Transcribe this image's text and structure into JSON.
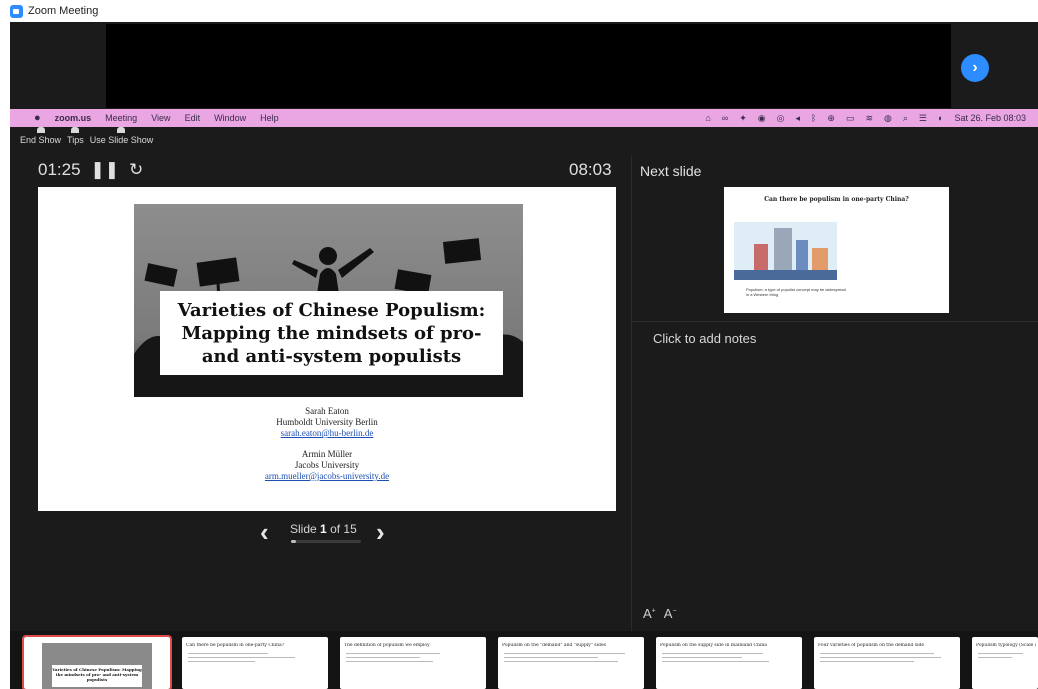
{
  "window": {
    "title": "Zoom Meeting"
  },
  "menubar": {
    "app_name": "zoom.us",
    "menus": [
      "Meeting",
      "View",
      "Edit",
      "Window",
      "Help"
    ],
    "datetime": "Sat 26. Feb 08:03"
  },
  "presenter_toolbar": {
    "items": [
      "End Show",
      "Tips",
      "Use Slide Show"
    ]
  },
  "timer": {
    "elapsed": "01:25",
    "clock": "08:03"
  },
  "current_slide": {
    "title": "Varieties of Chinese Populism: Mapping the mindsets of pro- and anti-system populists",
    "author1_name": "Sarah Eaton",
    "author1_affiliation": "Humboldt University Berlin",
    "author1_email": "sarah.eaton@hu-berlin.de",
    "author2_name": "Armin Müller",
    "author2_affiliation": "Jacobs University",
    "author2_email": "arm.mueller@jacobs-university.de"
  },
  "slide_nav": {
    "label": "Slide",
    "current": "1",
    "of": "of 15",
    "progress": 0.0667
  },
  "next_slide": {
    "label": "Next slide",
    "title": "Can there be populism in one-party China?",
    "caption": "Populism: a type of populist concept may be widespread in a Western thing"
  },
  "notes": {
    "placeholder": "Click to add notes"
  },
  "thumbnails": [
    {
      "title": "Varieties of Chinese Populism: Mapping the mindsets of pro- and anti-system populists",
      "active": true
    },
    {
      "title": "Can there be populism in one-party China?",
      "active": false
    },
    {
      "title": "The definition of populism we employ",
      "active": false
    },
    {
      "title": "Populism on the \"demand\" and \"supply\" sides",
      "active": false
    },
    {
      "title": "Populism on the supply side in mainland China",
      "active": false
    },
    {
      "title": "Four varieties of populism on the demand side",
      "active": false
    },
    {
      "title": "Populism typology (Scale and measurement)",
      "active": false
    }
  ],
  "colors": {
    "zoom_blue": "#2d8cff",
    "menubar_pink": "#e9a6e2",
    "active_thumb_border": "#e04c4c",
    "background_dark": "#1b1b1c"
  },
  "icons": {
    "pause": "pause-icon",
    "reset": "reset-icon",
    "prev": "chevron-left-icon",
    "next": "chevron-right-icon",
    "next_circle": "chevron-circle-right-icon"
  }
}
